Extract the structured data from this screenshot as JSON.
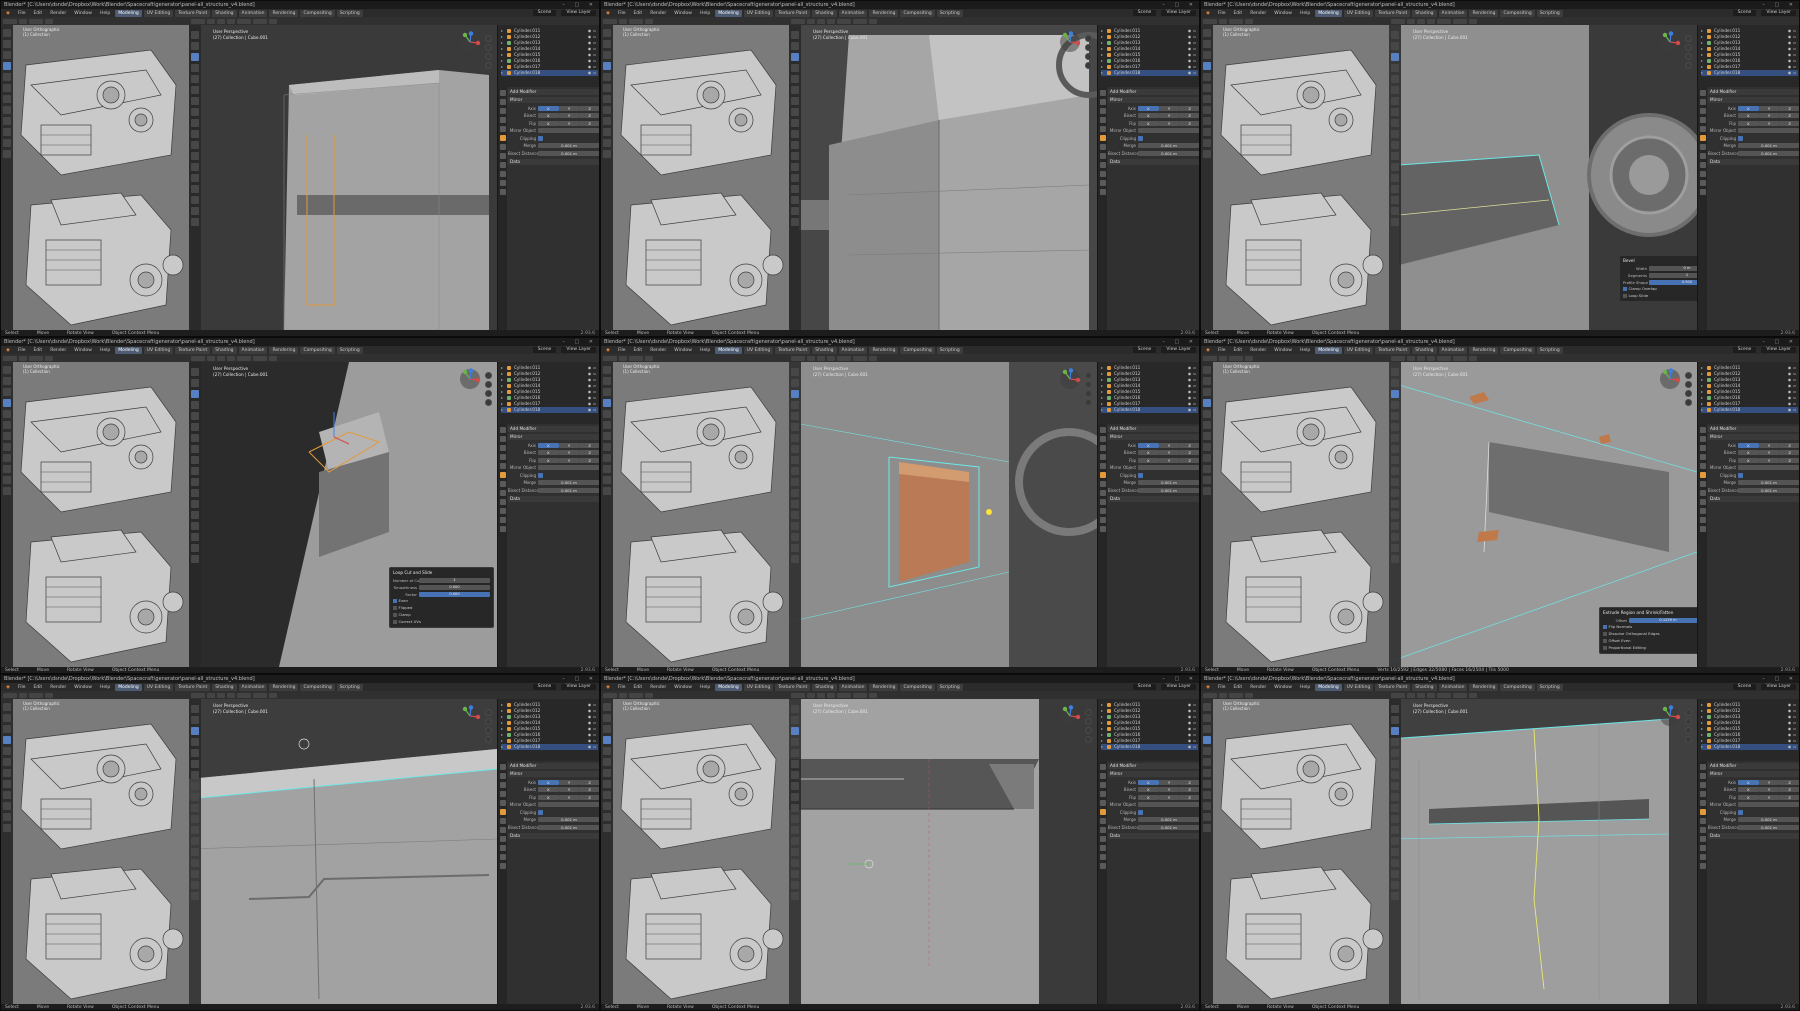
{
  "app": {
    "title": "Blender* [C:\\Users\\dsnde\\Dropbox\\Work\\Blender\\Spacecraft\\generator\\panel-all_structure_v4.blend]",
    "version": "2.93.6",
    "scene": "Scene",
    "view_layer": "View Layer",
    "menus": [
      "File",
      "Edit",
      "Render",
      "Window",
      "Help"
    ],
    "workspaces": [
      "Modeling",
      "UV Editing",
      "Texture Paint",
      "Shading",
      "Animation",
      "Rendering",
      "Compositing",
      "Scripting"
    ],
    "active_workspace": "Modeling",
    "viewport_label_1": "User Perspective",
    "viewport_label_2": "(27) Collection | Cube.001",
    "reference_label_1": "User Orthographic",
    "reference_label_2": "(1) Collection"
  },
  "outliner_items": [
    "Cylinder.011",
    "Cylinder.012",
    "Cylinder.013",
    "Cylinder.014",
    "Cylinder.015",
    "Cylinder.016",
    "Cylinder.017",
    "Cylinder.018"
  ],
  "properties": {
    "panel_title": "Add Modifier",
    "modifier_name": "Mirror",
    "axis_label": "Axis",
    "bisect_label": "Bisect",
    "flip_label": "Flip",
    "mirror_object_label": "Mirror Object",
    "clipping_label": "Clipping",
    "merge_label": "Merge",
    "merge_value": "0.001 m",
    "bisect_distance_label": "Bisect Distance",
    "bisect_distance_value": "0.001 m",
    "data_label": "Data",
    "x": "X",
    "y": "Y",
    "z": "Z"
  },
  "operator_panels": {
    "bevel": {
      "title": "Bevel",
      "rows": [
        [
          "Width",
          "0 m"
        ],
        [
          "Segments",
          "1"
        ],
        [
          "Profile Shape",
          "0.500"
        ]
      ],
      "checks": [
        "Clamp Overlap",
        "Loop Slide"
      ]
    },
    "loopcut": {
      "title": "Loop Cut and Slide",
      "rows": [
        [
          "Number of Cuts",
          "1"
        ],
        [
          "Smoothness",
          "0.000"
        ],
        [
          "Factor",
          "0.000"
        ]
      ],
      "checks": [
        "Even",
        "Flipped",
        "Clamp",
        "Correct UVs"
      ]
    },
    "extrude": {
      "title": "Extrude Region and Shrink/Fatten",
      "rows": [
        [
          "Offset",
          "0.1229 m"
        ]
      ],
      "checks": [
        "Flip Normals",
        "Dissolve Orthogonal Edges",
        "Offset Even",
        "Proportional Editing"
      ]
    }
  },
  "status": {
    "items": [
      "Select",
      "Move",
      "Rotate View",
      "Object Context Menu"
    ],
    "cell6_stats": "Verts 16/2592 | Edges 32/5080 | Faces 16/2504 | Tris 5000"
  },
  "colors": {
    "accent_blue": "#4772b3",
    "selection_orange": "#e39a3b",
    "edge_cyan": "#6ee6e6",
    "mesh_grey": "#9a9a9a"
  }
}
